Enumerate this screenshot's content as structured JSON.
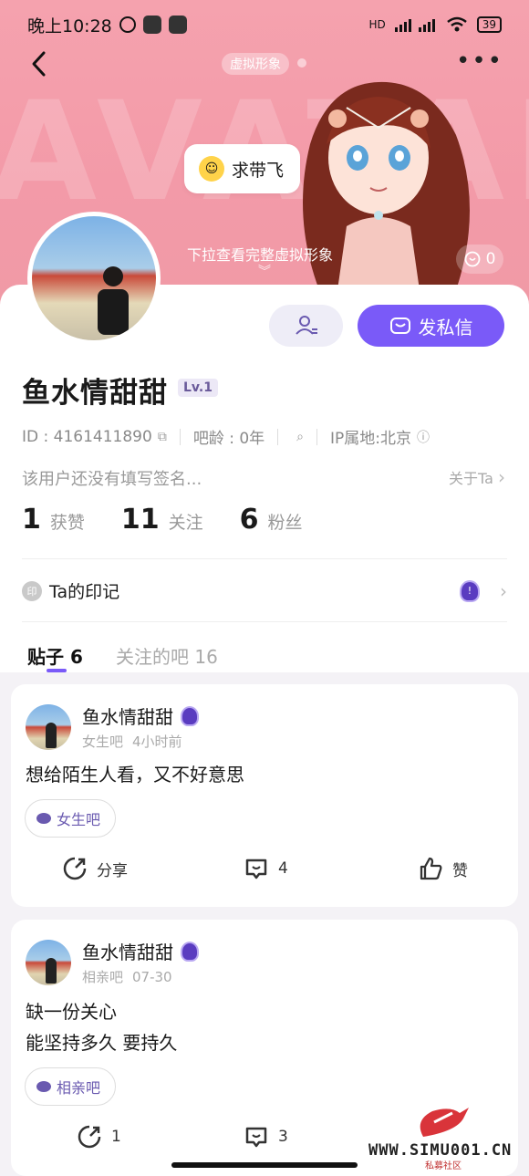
{
  "status_bar": {
    "time": "晚上10:28",
    "signal_hd": "HD",
    "battery": "39"
  },
  "header": {
    "avatar_tag": "虚拟形象",
    "bubble_text": "求带飞",
    "hint": "下拉查看完整虚拟形象",
    "likes": "0"
  },
  "profile": {
    "name": "鱼水情甜甜",
    "level": "Lv.1",
    "id": "ID : 4161411890",
    "age": "吧龄 : 0年",
    "ip": "IP属地:北京",
    "signature": "该用户还没有填写签名...",
    "about": "关于Ta",
    "message_button": "发私信",
    "stats": [
      {
        "num": "1",
        "label": "获赞"
      },
      {
        "num": "11",
        "label": "关注"
      },
      {
        "num": "6",
        "label": "粉丝"
      }
    ],
    "mark_label": "Ta的印记",
    "mark_icon_text": "印"
  },
  "tabs": {
    "posts_label": "贴子",
    "posts_count": "6",
    "followed_label": "关注的吧",
    "followed_count": "16"
  },
  "posts": [
    {
      "author": "鱼水情甜甜",
      "forum": "女生吧",
      "time": "4小时前",
      "line1": "想给陌生人看，又不好意思",
      "line2": "",
      "chip": "女生吧",
      "share": "分享",
      "comments": "4",
      "like": "赞"
    },
    {
      "author": "鱼水情甜甜",
      "forum": "相亲吧",
      "time": "07-30",
      "line1": "缺一份关心",
      "line2": "能坚持多久 要持久",
      "chip": "相亲吧",
      "share": "1",
      "comments": "3",
      "like": ""
    }
  ],
  "watermark": {
    "text": "WWW.SIMU001.CN",
    "sub": "私募社区"
  }
}
